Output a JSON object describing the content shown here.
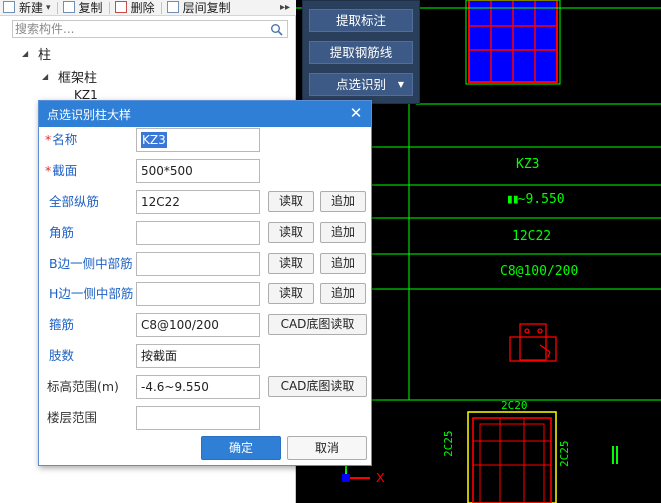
{
  "toolbar": {
    "new_label": "新建",
    "copy_label": "复制",
    "delete_label": "删除",
    "floor_copy_label": "层间复制",
    "more_icon": "double-chevron-right-icon"
  },
  "search": {
    "placeholder": "搜索构件..."
  },
  "tree": {
    "root_label": "柱",
    "child_label": "框架柱",
    "leaf_label": "KZ1"
  },
  "side_panel": {
    "extract_annotation_label": "提取标注",
    "extract_rebar_line_label": "提取钢筋线",
    "point_identify_label": "点选识别"
  },
  "dialog": {
    "title": "点选识别柱大样",
    "close_icon": "close-icon",
    "fields": {
      "name": {
        "label": "名称",
        "value": "KZ3",
        "required": true
      },
      "section": {
        "label": "截面",
        "value": "500*500",
        "required": true
      },
      "all_long_rebar": {
        "label": "全部纵筋",
        "value": "12C22"
      },
      "corner_rebar": {
        "label": "角筋",
        "value": ""
      },
      "b_side_rebar": {
        "label": "B边一侧中部筋",
        "value": ""
      },
      "h_side_rebar": {
        "label": "H边一侧中部筋",
        "value": ""
      },
      "stirrup": {
        "label": "箍筋",
        "value": "C8@100/200"
      },
      "limbs": {
        "label": "肢数",
        "value": "按截面"
      },
      "elevation_range": {
        "label": "标高范围(m)",
        "value": "-4.6~9.550"
      },
      "floor_range": {
        "label": "楼层范围",
        "value": ""
      }
    },
    "read_label": "读取",
    "append_label": "追加",
    "cad_read_label": "CAD底图读取",
    "ok_label": "确定",
    "cancel_label": "取消"
  },
  "cad": {
    "annotations": {
      "name": "KZ3",
      "elevation": "9.550",
      "long_rebar": "12C22",
      "stirrup": "C8@100/200",
      "top_rebar": "2C20",
      "left_rebar": "2C25",
      "right_rebar": "2C25"
    },
    "axis_x_label": "X",
    "colors": {
      "background": "#000000",
      "grid_line": "#00ff00",
      "rebar": "#ff0000",
      "fill": "#0000ff",
      "outline": "#ffff00",
      "axis_x": "#ff0000",
      "axis_y": "#00ff00"
    }
  }
}
